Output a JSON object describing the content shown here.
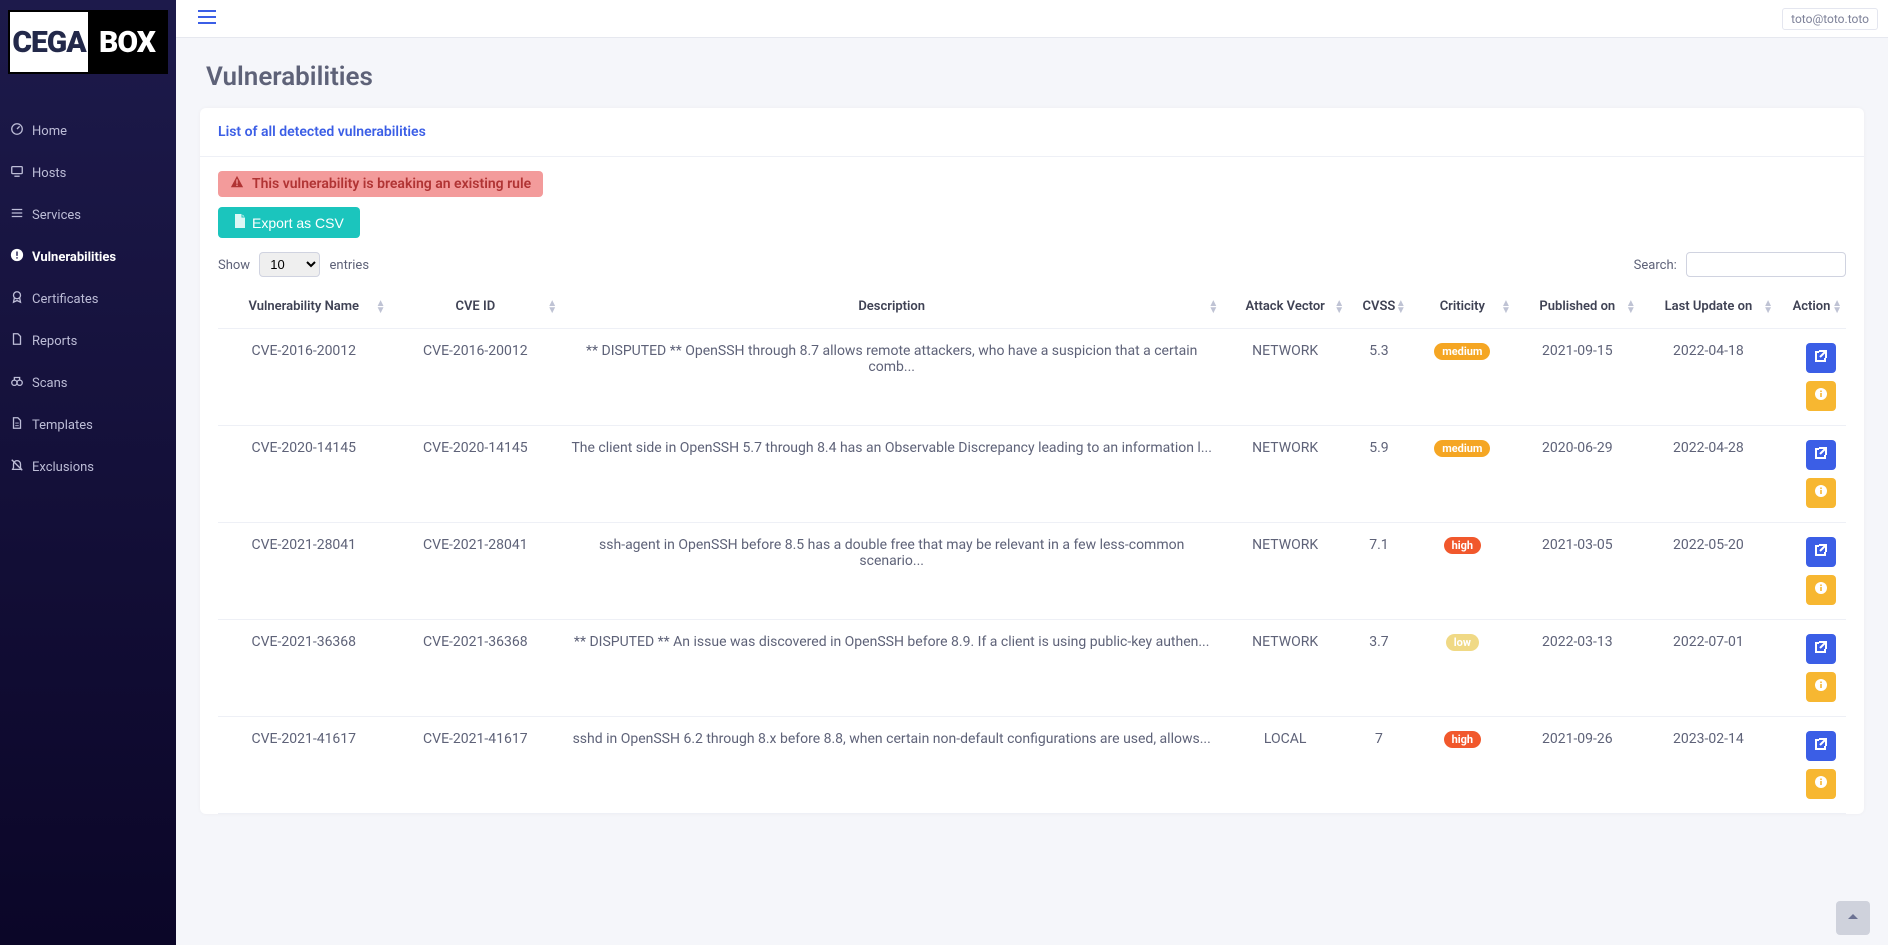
{
  "logo": {
    "left": "CEGA",
    "right": "BOX"
  },
  "nav": [
    {
      "label": "Home",
      "icon": "dashboard"
    },
    {
      "label": "Hosts",
      "icon": "monitor"
    },
    {
      "label": "Services",
      "icon": "menu"
    },
    {
      "label": "Vulnerabilities",
      "icon": "alert"
    },
    {
      "label": "Certificates",
      "icon": "award"
    },
    {
      "label": "Reports",
      "icon": "file"
    },
    {
      "label": "Scans",
      "icon": "binoculars"
    },
    {
      "label": "Templates",
      "icon": "doc"
    },
    {
      "label": "Exclusions",
      "icon": "bell-off"
    }
  ],
  "active_nav_index": 3,
  "user_email": "toto@toto.toto",
  "page_title": "Vulnerabilities",
  "card_title": "List of all detected vulnerabilities",
  "alert_text": "This vulnerability is breaking an existing rule",
  "export_label": "Export as CSV",
  "show_label_pre": "Show",
  "show_label_post": "entries",
  "show_value": "10",
  "search_label": "Search:",
  "search_value": "",
  "columns": [
    "Vulnerability Name",
    "CVE ID",
    "Description",
    "Attack Vector",
    "CVSS",
    "Criticity",
    "Published on",
    "Last Update on",
    "Action"
  ],
  "rows": [
    {
      "name": "CVE-2016-20012",
      "cve": "CVE-2016-20012",
      "desc": "** DISPUTED ** OpenSSH through 8.7 allows remote attackers, who have a suspicion that a certain comb...",
      "vector": "NETWORK",
      "cvss": "5.3",
      "criticity": "medium",
      "published": "2021-09-15",
      "updated": "2022-04-18"
    },
    {
      "name": "CVE-2020-14145",
      "cve": "CVE-2020-14145",
      "desc": "The client side in OpenSSH 5.7 through 8.4 has an Observable Discrepancy leading to an information l...",
      "vector": "NETWORK",
      "cvss": "5.9",
      "criticity": "medium",
      "published": "2020-06-29",
      "updated": "2022-04-28"
    },
    {
      "name": "CVE-2021-28041",
      "cve": "CVE-2021-28041",
      "desc": "ssh-agent in OpenSSH before 8.5 has a double free that may be relevant in a few less-common scenario...",
      "vector": "NETWORK",
      "cvss": "7.1",
      "criticity": "high",
      "published": "2021-03-05",
      "updated": "2022-05-20"
    },
    {
      "name": "CVE-2021-36368",
      "cve": "CVE-2021-36368",
      "desc": "** DISPUTED ** An issue was discovered in OpenSSH before 8.9. If a client is using public-key authen...",
      "vector": "NETWORK",
      "cvss": "3.7",
      "criticity": "low",
      "published": "2022-03-13",
      "updated": "2022-07-01"
    },
    {
      "name": "CVE-2021-41617",
      "cve": "CVE-2021-41617",
      "desc": "sshd in OpenSSH 6.2 through 8.x before 8.8, when certain non-default configurations are used, allows...",
      "vector": "LOCAL",
      "cvss": "7",
      "criticity": "high",
      "published": "2021-09-26",
      "updated": "2023-02-14"
    }
  ]
}
